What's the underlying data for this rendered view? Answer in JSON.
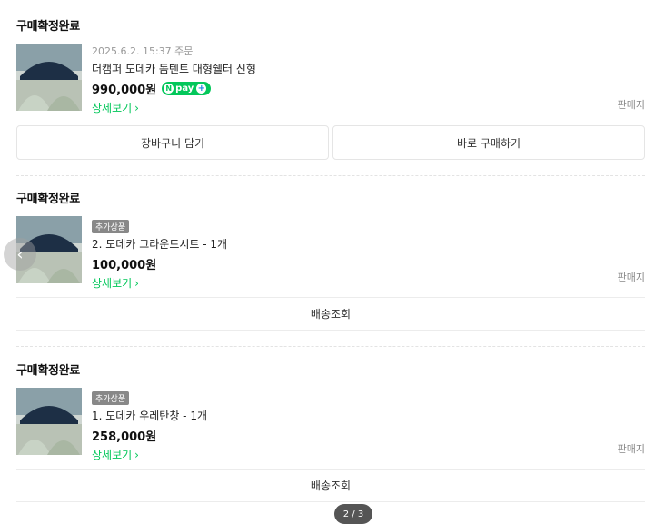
{
  "orders": [
    {
      "status": "구매확정완료",
      "date": "2025.6.2. 15:37 주문",
      "badge": "",
      "product_name": "더캠퍼 도데카 돔텐트 대형쉘터 신형",
      "price": "990,000원",
      "npay": "pay",
      "detail_link": "상세보기",
      "seller_label": "판매지",
      "buttons": [
        "장바구니 담기",
        "바로 구매하기"
      ]
    },
    {
      "status": "구매확정완료",
      "badge": "추가상품",
      "product_name": "2. 도데카 그라운드시트 - 1개",
      "price": "100,000원",
      "detail_link": "상세보기",
      "seller_label": "판매지",
      "track_label": "배송조회"
    },
    {
      "status": "구매확정완료",
      "badge": "추가상품",
      "product_name": "1. 도데카 우레탄창 - 1개",
      "price": "258,000원",
      "detail_link": "상세보기",
      "seller_label": "판매지",
      "track_label": "배송조회"
    }
  ],
  "pager": "2 / 3",
  "icons": {
    "prev": "chevron-left-icon",
    "detail": "chevron-right-icon"
  },
  "colors": {
    "accent": "#03c75a",
    "npay": "#03c75a"
  }
}
